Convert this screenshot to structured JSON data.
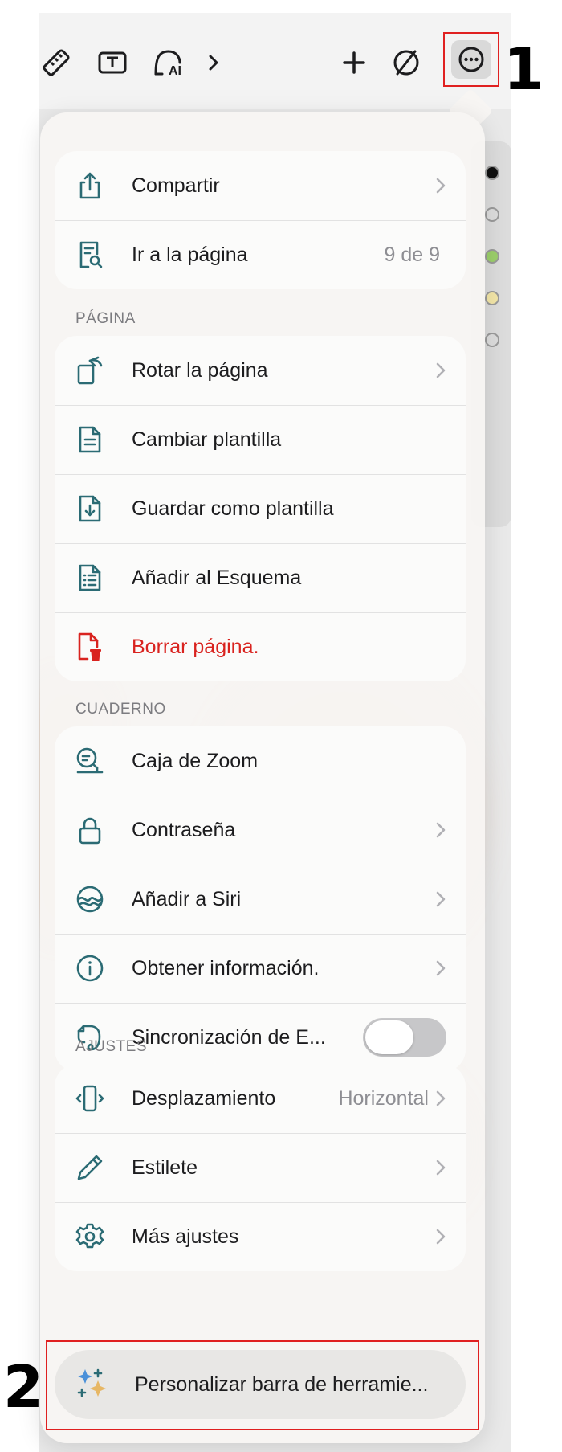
{
  "annotations": {
    "step1": "1",
    "step2": "2"
  },
  "toolbar": {
    "icons": [
      "ruler-icon",
      "text-box-icon",
      "ai-assistant-icon",
      "chevron-right-icon",
      "plus-icon",
      "no-selection-icon",
      "more-icon"
    ],
    "ai_label": "AI"
  },
  "menu": {
    "top_group": {
      "share": {
        "label": "Compartir",
        "icon": "share-icon"
      },
      "goto_page": {
        "label": "Ir a la página",
        "value": "9 de 9",
        "icon": "page-search-icon"
      }
    },
    "page_section": {
      "header": "PÁGINA",
      "items": [
        {
          "label": "Rotar la página",
          "icon": "rotate-page-icon",
          "chevron": true
        },
        {
          "label": "Cambiar plantilla",
          "icon": "template-icon",
          "chevron": false
        },
        {
          "label": "Guardar como plantilla",
          "icon": "save-template-icon",
          "chevron": false
        },
        {
          "label": "Añadir al Esquema",
          "icon": "outline-icon",
          "chevron": false
        },
        {
          "label": "Borrar página.",
          "icon": "delete-page-icon",
          "chevron": false,
          "destructive": true
        }
      ]
    },
    "notebook_section": {
      "header": "CUADERNO",
      "items": [
        {
          "label": "Caja de Zoom",
          "icon": "zoom-box-icon",
          "chevron": false
        },
        {
          "label": "Contraseña",
          "icon": "lock-icon",
          "chevron": true
        },
        {
          "label": "Añadir a Siri",
          "icon": "siri-icon",
          "chevron": true
        },
        {
          "label": "Obtener información.",
          "icon": "info-icon",
          "chevron": true
        }
      ],
      "sync": {
        "label": "Sincronización de E...",
        "icon": "evernote-icon",
        "enabled": false
      }
    },
    "settings_section": {
      "header": "AJUSTES",
      "items": [
        {
          "label": "Desplazamiento",
          "value": "Horizontal",
          "icon": "scroll-device-icon",
          "chevron": true
        },
        {
          "label": "Estilete",
          "icon": "pencil-icon",
          "chevron": true
        },
        {
          "label": "Más ajustes",
          "icon": "gear-icon",
          "chevron": true
        }
      ]
    },
    "customize": {
      "label": "Personalizar barra de herramie...",
      "icon": "sparkles-icon"
    }
  },
  "colors": {
    "accent": "#2b6b74",
    "destructive": "#d9231f",
    "annotation": "#e02020"
  }
}
